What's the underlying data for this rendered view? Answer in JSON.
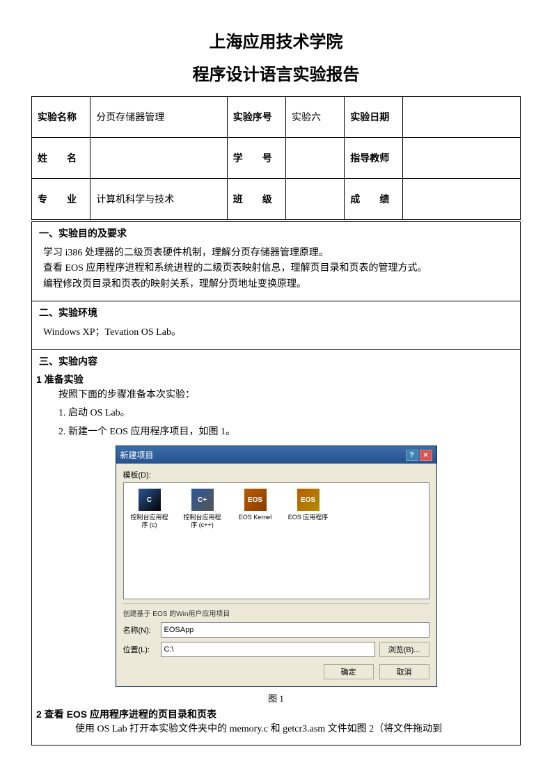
{
  "title_main": "上海应用技术学院",
  "title_sub": "程序设计语言实验报告",
  "info": {
    "exp_name_label": "实验名称",
    "exp_name_value": "分页存储器管理",
    "exp_no_label": "实验序号",
    "exp_no_value": "实验六",
    "exp_date_label": "实验日期",
    "exp_date_value": "",
    "name_label": "姓　　名",
    "name_value": "",
    "sid_label": "学　　号",
    "sid_value": "",
    "teacher_label": "指导教师",
    "teacher_value": "",
    "major_label": "专　　业",
    "major_value": "计算机科学与技术",
    "class_label": "班　　级",
    "class_value": "",
    "score_label": "成　　绩",
    "score_value": ""
  },
  "sec1": {
    "heading": "一、实验目的及要求",
    "p1": "学习 i386 处理器的二级页表硬件机制，理解分页存储器管理原理。",
    "p2": "查看 EOS 应用程序进程和系统进程的二级页表映射信息，理解页目录和页表的管理方式。",
    "p3": "编程修改页目录和页表的映射关系，理解分页地址变换原理。"
  },
  "sec2": {
    "heading": "二、实验环境",
    "p1": "Windows XP；Tevation OS Lab。"
  },
  "sec3": {
    "heading": "三、实验内容",
    "h1": "1 准备实验",
    "p1": "按照下面的步骤准备本次实验：",
    "step1": "1. 启动 OS Lab。",
    "step2": "2. 新建一个 EOS 应用程序项目，如图 1。",
    "fig_caption": "图 1",
    "h2": "2 查看 EOS 应用程序进程的页目录和页表",
    "p2": "使用 OS Lab 打开本实验文件夹中的 memory.c 和 getcr3.asm 文件如图 2（将文件拖动到"
  },
  "dialog": {
    "title": "新建项目",
    "type_label": "模板(D):",
    "items": [
      {
        "name": "控制台应用程序 (c)"
      },
      {
        "name": "控制台应用程序 (c++)"
      },
      {
        "name": "EOS Kernel"
      },
      {
        "name": "EOS 应用程序"
      }
    ],
    "desc": "创建基于 EOS 的Win用户应用项目",
    "name_label": "名称(N):",
    "name_value": "EOSApp",
    "loc_label": "位置(L):",
    "loc_value": "C:\\",
    "browse_btn": "浏览(B)...",
    "ok_btn": "确定",
    "cancel_btn": "取消"
  }
}
